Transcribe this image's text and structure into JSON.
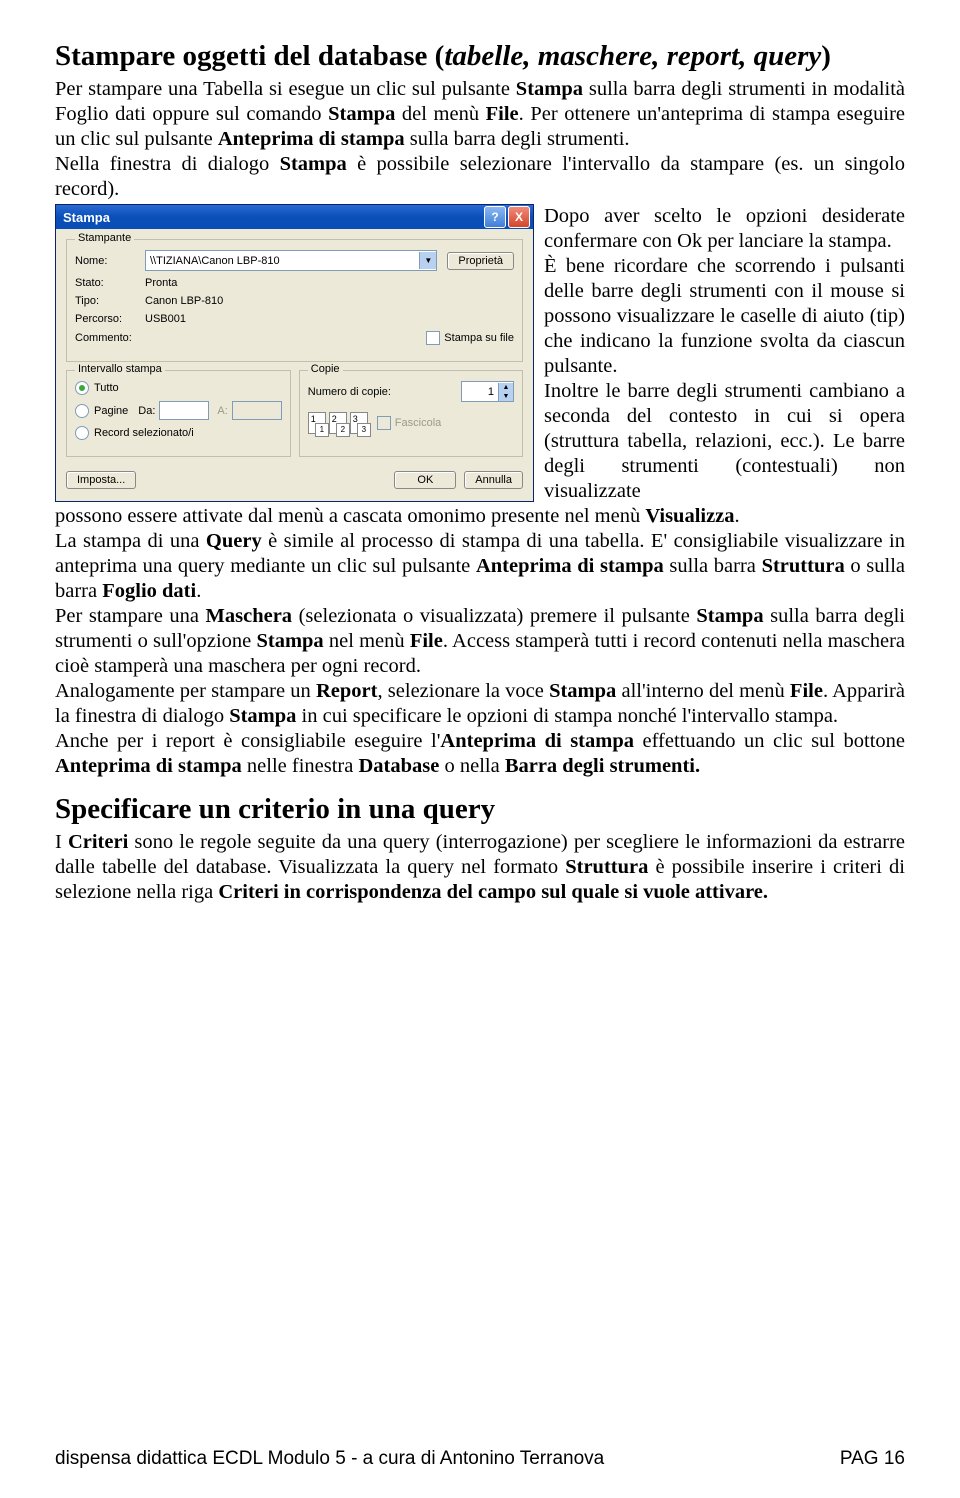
{
  "heading1_html": "Stampare oggetti del database (<i>tabelle, maschere, report, query</i>)",
  "p1_html": "Per stampare una Tabella si esegue un clic sul pulsante <b>Stampa</b> sulla barra degli strumenti in modalità Foglio dati oppure sul comando <b>Stampa</b> del menù <b>File</b>. Per ottenere un'anteprima di stampa eseguire un clic sul pulsante <b>Anteprima di stampa</b> sulla barra degli strumenti.",
  "p2_html": "Nella finestra di dialogo <b>Stampa</b> è possibile selezionare l'intervallo da stampare (es. un singolo record).",
  "right_html": "Dopo aver scelto le opzioni desiderate confermare con Ok per lanciare la stampa.<br>È bene ricordare che scorrendo i pulsanti delle barre degli strumenti con il mouse si possono visualizzare le caselle di aiuto (tip) che indicano la funzione svolta da ciascun pulsante.<br>Inoltre le barre degli strumenti cambiano a seconda del contesto in cui si opera (struttura tabella, relazioni, ecc.). Le barre degli strumenti (contestuali) non visualizzate",
  "p3_html": "possono essere attivate dal menù a cascata omonimo presente nel menù <b>Visualizza</b>.<br>La stampa di una <b>Query</b> è simile al processo di stampa di una tabella. E' consigliabile visualizzare in anteprima una query mediante un clic sul pulsante <b>Anteprima di stampa</b> sulla barra <b>Struttura</b> o sulla barra <b>Foglio dati</b>.<br>Per stampare una <b>Maschera</b> (selezionata o visualizzata) premere il pulsante <b>Stampa</b> sulla barra degli strumenti o sull'opzione <b>Stampa</b> nel menù <b>File</b>. Access stamperà tutti i record contenuti nella maschera cioè stamperà una maschera per ogni record.<br>Analogamente per stampare un <b>Report</b>, selezionare la voce <b>Stampa</b> all'interno del menù <b>File</b>. Apparirà la finestra di dialogo <b>Stampa</b>  in cui specificare le opzioni di stampa nonché l'intervallo stampa.<br>Anche per i report è consigliabile eseguire l'<b>Anteprima di stampa</b> effettuando un clic sul bottone <b>Anteprima di stampa</b> nelle finestra <b>Database</b> o nella <b>Barra degli strumenti.</b>",
  "heading2": "Specificare un criterio in una query",
  "p4_html": "I <b>Criteri</b> sono le regole seguite da una query (interrogazione) per scegliere le informazioni da estrarre dalle tabelle del database. Visualizzata la query nel formato <b>Struttura</b> è possibile inserire i criteri di selezione nella riga <b>Criteri in corrispondenza del campo sul quale si vuole attivare.</b>",
  "footer_left": "dispensa didattica ECDL Modulo 5 - a cura di Antonino Terranova",
  "footer_right": "PAG 16",
  "dlg": {
    "title": "Stampa",
    "printer_group": "Stampante",
    "name_lbl": "Nome:",
    "name_val": "\\\\TIZIANA\\Canon LBP-810",
    "prop_btn": "Proprietà",
    "state_lbl": "Stato:",
    "state_val": "Pronta",
    "type_lbl": "Tipo:",
    "type_val": "Canon LBP-810",
    "path_lbl": "Percorso:",
    "path_val": "USB001",
    "comment_lbl": "Commento:",
    "print_to_file": "Stampa su file",
    "range_group": "Intervallo stampa",
    "all": "Tutto",
    "pages": "Pagine",
    "from": "Da:",
    "to": "A:",
    "selected": "Record selezionato/i",
    "copies_group": "Copie",
    "copies_lbl": "Numero di copie:",
    "copies_val": "1",
    "collate": "Fascicola",
    "setup": "Imposta...",
    "ok": "OK",
    "cancel": "Annulla"
  }
}
